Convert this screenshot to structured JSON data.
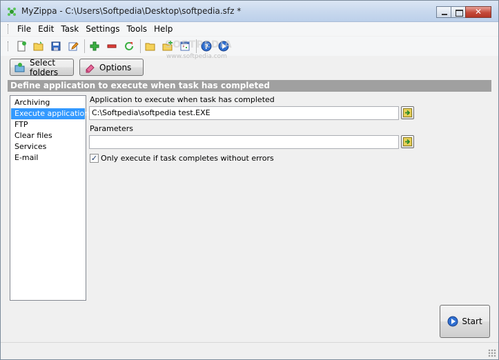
{
  "window": {
    "title": "MyZippa - C:\\Users\\Softpedia\\Desktop\\softpedia.sfz *"
  },
  "menu": [
    "File",
    "Edit",
    "Task",
    "Settings",
    "Tools",
    "Help"
  ],
  "toolbar": {
    "icons": [
      "new-icon",
      "open-folder-icon",
      "save-icon",
      "edit-icon",
      "add-icon",
      "remove-icon",
      "refresh-icon",
      "folder-icon",
      "add-folder-icon",
      "calendar-icon",
      "help-icon",
      "run-icon"
    ],
    "watermark": "SOFTPEDIA",
    "watermark_sub": "www.softpedia.com"
  },
  "buttons": {
    "select_folders": "Select folders",
    "options": "Options",
    "start": "Start"
  },
  "section_header": "Define application to execute when task has completed",
  "task_list": {
    "items": [
      "Archiving",
      "Execute application",
      "FTP",
      "Clear files",
      "Services",
      "E-mail"
    ],
    "selected": "Execute application"
  },
  "form": {
    "app_label": "Application to execute when task has completed",
    "app_value": "C:\\Softpedia\\softpedia test.EXE",
    "params_label": "Parameters",
    "params_value": "",
    "only_execute_label": "Only execute if task completes without errors",
    "only_execute_checked": true
  },
  "colors": {
    "selection": "#3399ff",
    "header_bg": "#a0a0a0"
  }
}
